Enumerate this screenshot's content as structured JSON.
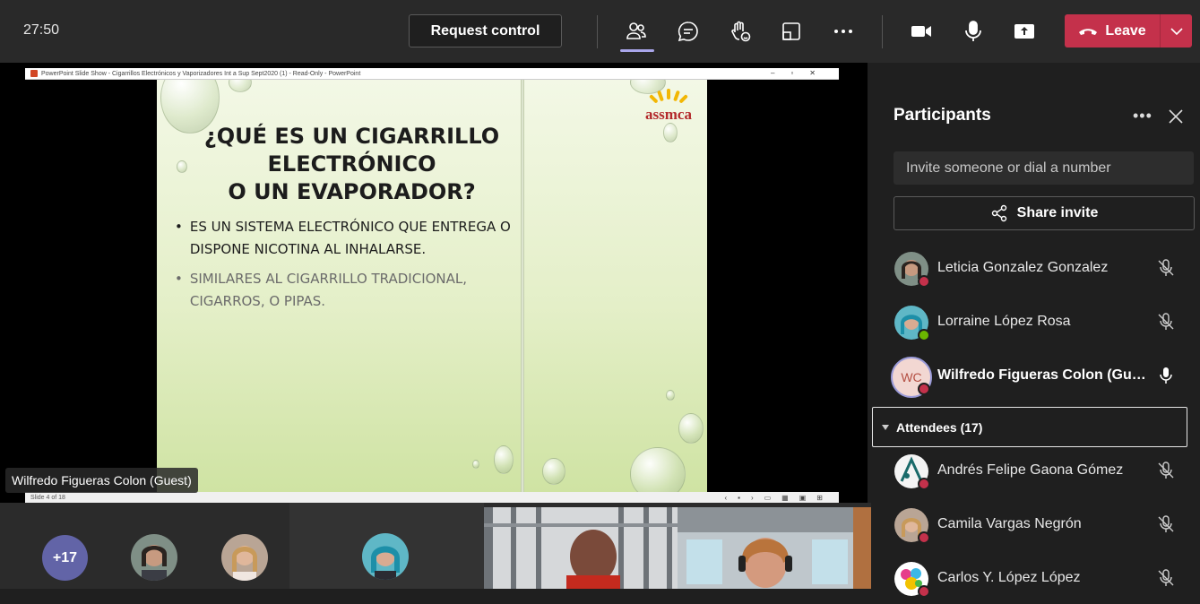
{
  "topbar": {
    "timer": "27:50",
    "request_control": "Request control",
    "leave_label": "Leave"
  },
  "colors": {
    "leave": "#c4314b",
    "accent": "#6264a7",
    "active_indicator": "#a9a6ea"
  },
  "presentation": {
    "window_title": "PowerPoint Slide Show - Cigarrillos Electrónicos y Vaporizadores Int a Sup Sept2020 (1) - Read-Only - PowerPoint",
    "slide_title_line1": "¿QUÉ ES UN CIGARRILLO",
    "slide_title_line2": "ELECTRÓNICO",
    "slide_title_line3": "O UN EVAPORADOR?",
    "bullet1": "ES UN SISTEMA ELECTRÓNICO QUE ENTREGA O DISPONE NICOTINA AL INHALARSE.",
    "bullet2": "SIMILARES AL CIGARRILLO TRADICIONAL, CIGARROS, O PIPAS.",
    "logo_text": "assmca",
    "status_text": "Slide 4 of 18",
    "presenter_name": "Wilfredo Figueras Colon (Guest)"
  },
  "gallery": {
    "overflow_count": "+17"
  },
  "participants_panel": {
    "title": "Participants",
    "invite_placeholder": "Invite someone or dial a number",
    "share_invite": "Share invite",
    "attendees_header": "Attendees (17)",
    "presenters": [
      {
        "name": "Leticia Gonzalez Gonzalez",
        "status": "busy",
        "mic": "muted"
      },
      {
        "name": "Lorraine López Rosa",
        "status": "available",
        "mic": "muted"
      },
      {
        "name": "Wilfredo Figueras Colon (Guest)",
        "initials": "WC",
        "status": "dnd",
        "mic": "on"
      }
    ],
    "attendees": [
      {
        "name": "Andrés Felipe Gaona Gómez",
        "status": "busy",
        "mic": "muted"
      },
      {
        "name": "Camila Vargas Negrón",
        "status": "busy",
        "mic": "muted"
      },
      {
        "name": "Carlos Y. López López",
        "status": "busy",
        "mic": "muted"
      }
    ]
  }
}
